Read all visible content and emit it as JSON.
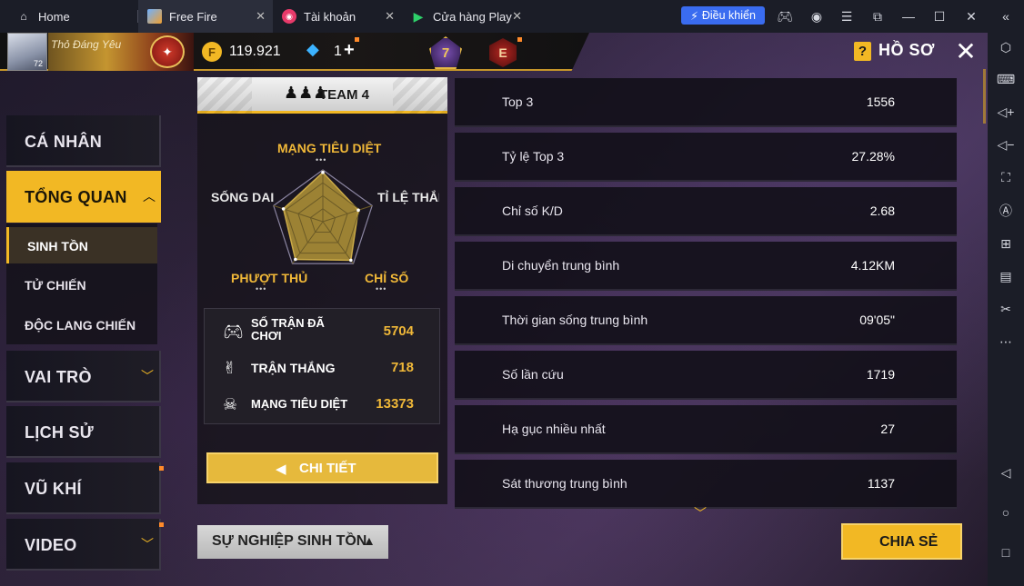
{
  "tabs": [
    {
      "label": "Home",
      "icon": "home-icon"
    },
    {
      "label": "Free Fire",
      "icon": "free-fire-icon"
    },
    {
      "label": "Tài khoản",
      "icon": "account-icon"
    },
    {
      "label": "Cửa hàng Play",
      "icon": "play-store-icon"
    }
  ],
  "window": {
    "control_label": "Điều khiển"
  },
  "header": {
    "player_name": "Thỏ Đáng Yêu",
    "avatar_level": "72",
    "coins": "119.921",
    "diamonds": "1",
    "rank_tier": "7",
    "rank_badge": "E",
    "profile_title": "HỒ SƠ"
  },
  "nav": {
    "items": [
      {
        "label": "CÁ NHÂN"
      },
      {
        "label": "TỔNG QUAN"
      },
      {
        "label": "VAI TRÒ"
      },
      {
        "label": "LỊCH SỬ"
      },
      {
        "label": "VŨ KHÍ"
      },
      {
        "label": "VIDEO"
      }
    ],
    "sub_items": [
      {
        "label": "SINH TỒN"
      },
      {
        "label": "TỬ CHIẾN"
      },
      {
        "label": "ĐỘC LANG CHIẾN"
      }
    ]
  },
  "team": {
    "title": "TEAM 4",
    "radar_labels": {
      "top": "MẠNG TIÊU DIỆT",
      "right": "TỈ LỆ THẮNG",
      "bottom_right": "CHỈ SỐ",
      "bottom_left": "PHƯỢT THỦ",
      "left": "SỐNG DAI"
    },
    "radar_values": [
      0.95,
      0.72,
      0.92,
      0.9,
      0.8
    ],
    "stats": [
      {
        "label": "SỐ TRẬN ĐÃ CHƠI",
        "value": "5704",
        "icon": "gamepad-icon"
      },
      {
        "label": "TRẬN THẮNG",
        "value": "718",
        "icon": "victory-hand-icon"
      },
      {
        "label": "MẠNG TIÊU DIỆT",
        "value": "13373",
        "icon": "skull-icon"
      }
    ],
    "detail_label": "CHI TIẾT"
  },
  "stats_list": [
    {
      "label": "Top 3",
      "value": "1556"
    },
    {
      "label": "Tỷ lệ Top 3",
      "value": "27.28%"
    },
    {
      "label": "Chỉ số K/D",
      "value": "2.68"
    },
    {
      "label": "Di chuyển trung bình",
      "value": "4.12KM"
    },
    {
      "label": "Thời gian sống trung bình",
      "value": "09'05\""
    },
    {
      "label": "Số lần cứu",
      "value": "1719"
    },
    {
      "label": "Hạ gục nhiều nhất",
      "value": "27"
    },
    {
      "label": "Sát thương trung bình",
      "value": "1137"
    }
  ],
  "bottom": {
    "career_label": "SỰ NGHIỆP SINH TỒN",
    "share_label": "CHIA SẺ"
  },
  "colors": {
    "accent": "#f2b824",
    "tab_active": "#2b2e3b",
    "control_blue": "#3a6cf0"
  }
}
